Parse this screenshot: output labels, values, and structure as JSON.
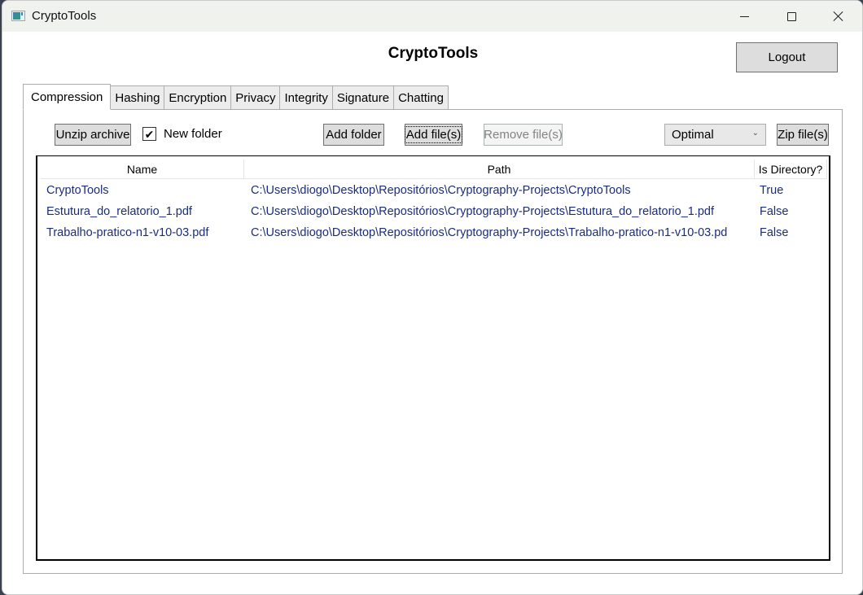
{
  "window": {
    "title": "CryptoTools",
    "controls": {
      "minimize": "minimize",
      "maximize": "maximize",
      "close": "close"
    }
  },
  "header": {
    "app_title": "CryptoTools",
    "logout_label": "Logout"
  },
  "tabs": [
    {
      "label": "Compression",
      "active": true
    },
    {
      "label": "Hashing",
      "active": false
    },
    {
      "label": "Encryption",
      "active": false
    },
    {
      "label": "Privacy",
      "active": false
    },
    {
      "label": "Integrity",
      "active": false
    },
    {
      "label": "Signature",
      "active": false
    },
    {
      "label": "Chatting",
      "active": false
    }
  ],
  "toolbar": {
    "unzip_label": "Unzip archive",
    "new_folder_label": "New folder",
    "new_folder_checked": true,
    "check_glyph": "✔",
    "add_folder_label": "Add folder",
    "add_files_label": "Add file(s)",
    "remove_files_label": "Remove file(s)",
    "remove_files_enabled": false,
    "compression_level": "Optimal",
    "chevron_glyph": "⌄",
    "zip_label": "Zip file(s)"
  },
  "file_list": {
    "columns": [
      "Name",
      "Path",
      "Is Directory?"
    ],
    "rows": [
      {
        "name": "CryptoTools",
        "path": "C:\\Users\\diogo\\Desktop\\Repositórios\\Cryptography-Projects\\CryptoTools",
        "is_directory": "True"
      },
      {
        "name": "Estutura_do_relatorio_1.pdf",
        "path": "C:\\Users\\diogo\\Desktop\\Repositórios\\Cryptography-Projects\\Estutura_do_relatorio_1.pdf",
        "is_directory": "False"
      },
      {
        "name": "Trabalho-pratico-n1-v10-03.pdf",
        "path": "C:\\Users\\diogo\\Desktop\\Repositórios\\Cryptography-Projects\\Trabalho-pratico-n1-v10-03.pd",
        "is_directory": "False"
      }
    ]
  }
}
